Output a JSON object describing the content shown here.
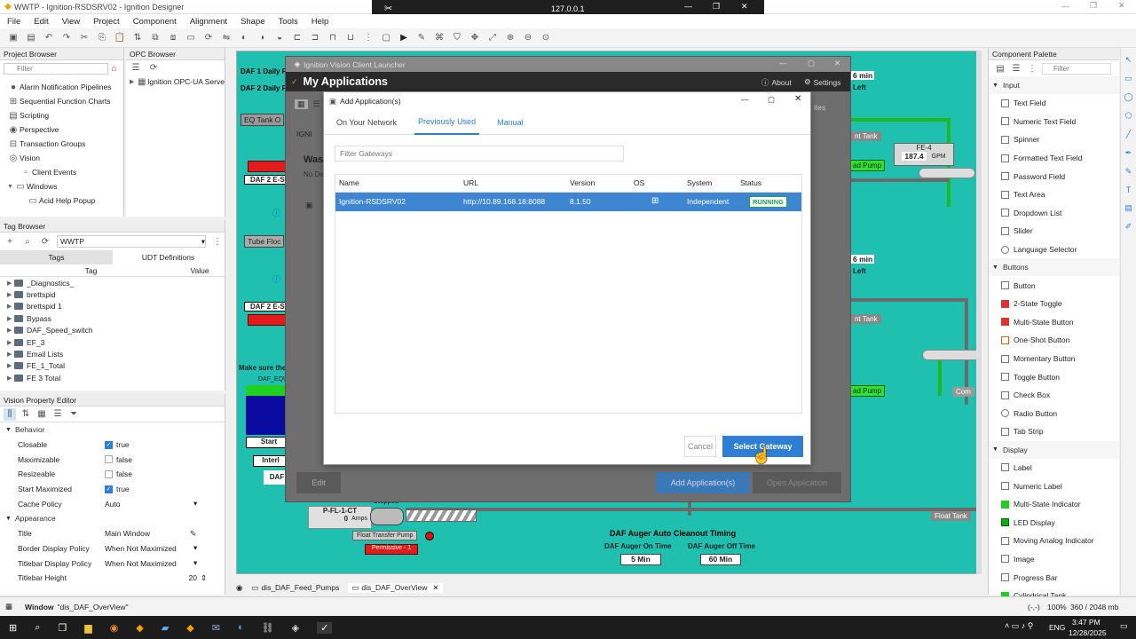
{
  "window": {
    "title": "WWTP - Ignition-RSDSRV02 - Ignition Designer"
  },
  "rdp": {
    "host": "127.0.0.1"
  },
  "menu": [
    "File",
    "Edit",
    "View",
    "Project",
    "Component",
    "Alignment",
    "Shape",
    "Tools",
    "Help"
  ],
  "project_browser": {
    "title": "Project Browser",
    "filter_placeholder": "Filter",
    "items": [
      "Alarm Notification Pipelines",
      "Sequential Function Charts",
      "Scripting",
      "Perspective",
      "Transaction Groups",
      "Vision",
      "Client Events",
      "Windows",
      "Acid Help Popup"
    ]
  },
  "opc_browser": {
    "title": "OPC Browser",
    "item": "Ignition OPC-UA Serve"
  },
  "tag_browser": {
    "title": "Tag Browser",
    "provider": "WWTP",
    "tabs": [
      "Tags",
      "UDT Definitions"
    ],
    "col_tag": "Tag",
    "col_value": "Value",
    "items": [
      "_Diagnostics_",
      "brettspid",
      "brettspid 1",
      "Bypass",
      "DAF_Speed_switch",
      "EF_3",
      "Email Lists",
      "FE_1_Total",
      "FE 3 Total"
    ]
  },
  "property_editor": {
    "title": "Vision Property Editor",
    "sections": [
      "Behavior",
      "Appearance"
    ],
    "behavior": [
      {
        "name": "Closable",
        "value": "true",
        "checked": true
      },
      {
        "name": "Maximizable",
        "value": "false",
        "checked": false
      },
      {
        "name": "Resizeable",
        "value": "false",
        "checked": false
      },
      {
        "name": "Start Maximized",
        "value": "true",
        "checked": true
      },
      {
        "name": "Cache Policy",
        "value": "Auto"
      }
    ],
    "appearance": [
      {
        "name": "Title",
        "value": "Main Window"
      },
      {
        "name": "Border Display Policy",
        "value": "When Not Maximized"
      },
      {
        "name": "Titlebar Display Policy",
        "value": "When Not Maximized"
      },
      {
        "name": "Titlebar Height",
        "value": "20"
      }
    ]
  },
  "canvas": {
    "labels": {
      "daf1": "DAF 1 Daily F",
      "daf2": "DAF 2 Daily F",
      "eq_tank": "EQ Tank O",
      "daf2_e1": "DAF 2 E-St",
      "tube": "Tube Floc",
      "daf2_e2": "DAF 2 E-St",
      "make_sure": "Make sure the",
      "daf_equ": "DAF_EQU",
      "start": "Start",
      "interl": "Interl",
      "daf": "DAF",
      "min_top": "6 min",
      "left_top": "Left",
      "min_mid": "6 min",
      "left_mid": "Left",
      "nt_tank1": "nt Tank",
      "nt_tank2": "nt Tank",
      "ad_pump1": "ad Pump",
      "ad_pump2": "ad Pump",
      "fe4": "FE-4",
      "fe4_val": "187.4",
      "fe4_unit": "GPM",
      "com": "Com",
      "float_tank": "Float Tank",
      "pfl": "P-FL-1-CT",
      "pfl_val": "0",
      "pfl_unit": "Amps",
      "stopped": "Stopped",
      "float_pump": "Float Transfer Pump",
      "permissive": "Permissive - 1",
      "auger_title": "DAF Auger Auto Cleanout Timing",
      "auger_on": "DAF Auger On Time",
      "auger_off": "DAF Auger Off Time",
      "on_val": "5 Min",
      "off_val": "60 Min"
    },
    "tabs": [
      "dis_DAF_Feed_Pumps",
      "dis_DAF_OverView"
    ]
  },
  "launcher": {
    "window_title": "Ignition Vision Client Launcher",
    "heading": "My Applications",
    "about": "About",
    "settings": "Settings",
    "sites": "ites",
    "wast": "Wast",
    "no_de": "No De",
    "ignit": "IGNI",
    "edit": "Edit",
    "add_apps": "Add Application(s)",
    "open_app": "Open Application"
  },
  "dialog": {
    "title": "Add Application(s)",
    "tabs": [
      "On Your Network",
      "Previously Used",
      "Manual"
    ],
    "filter_placeholder": "Filter Gateways",
    "columns": [
      "Name",
      "URL",
      "Version",
      "OS",
      "System",
      "Status"
    ],
    "row": {
      "name": "Ignition-RSDSRV02",
      "url": "http://10.89.168.18:8088",
      "version": "8.1.50",
      "system": "Independent",
      "status": "RUNNING"
    },
    "cancel": "Cancel",
    "select": "Select Gateway"
  },
  "palette": {
    "title": "Component Palette",
    "filter_placeholder": "Filter",
    "sections": [
      {
        "name": "Input",
        "items": [
          "Text Field",
          "Numeric Text Field",
          "Spinner",
          "Formatted Text Field",
          "Password Field",
          "Text Area",
          "Dropdown List",
          "Slider",
          "Language Selector"
        ]
      },
      {
        "name": "Buttons",
        "items": [
          "Button",
          "2-State Toggle",
          "Multi-State Button",
          "One-Shot Button",
          "Momentary Button",
          "Toggle Button",
          "Check Box",
          "Radio Button",
          "Tab Strip"
        ]
      },
      {
        "name": "Display",
        "items": [
          "Label",
          "Numeric Label",
          "Multi-State Indicator",
          "LED Display",
          "Moving Analog Indicator",
          "Image",
          "Progress Bar",
          "Cylindrical Tank"
        ]
      }
    ]
  },
  "status": {
    "window": "Window",
    "window_name": "\"dis_DAF_OverView\"",
    "zoom": "100%",
    "memory": "360 / 2048 mb",
    "coords": "(-,-)"
  },
  "taskbar": {
    "lang": "ENG",
    "time": "3:47 PM",
    "date": "12/28/2025"
  },
  "colors": {
    "canvas": "#20c0b0",
    "accent": "#2e7fd3",
    "status_running": "#1fa34a"
  }
}
